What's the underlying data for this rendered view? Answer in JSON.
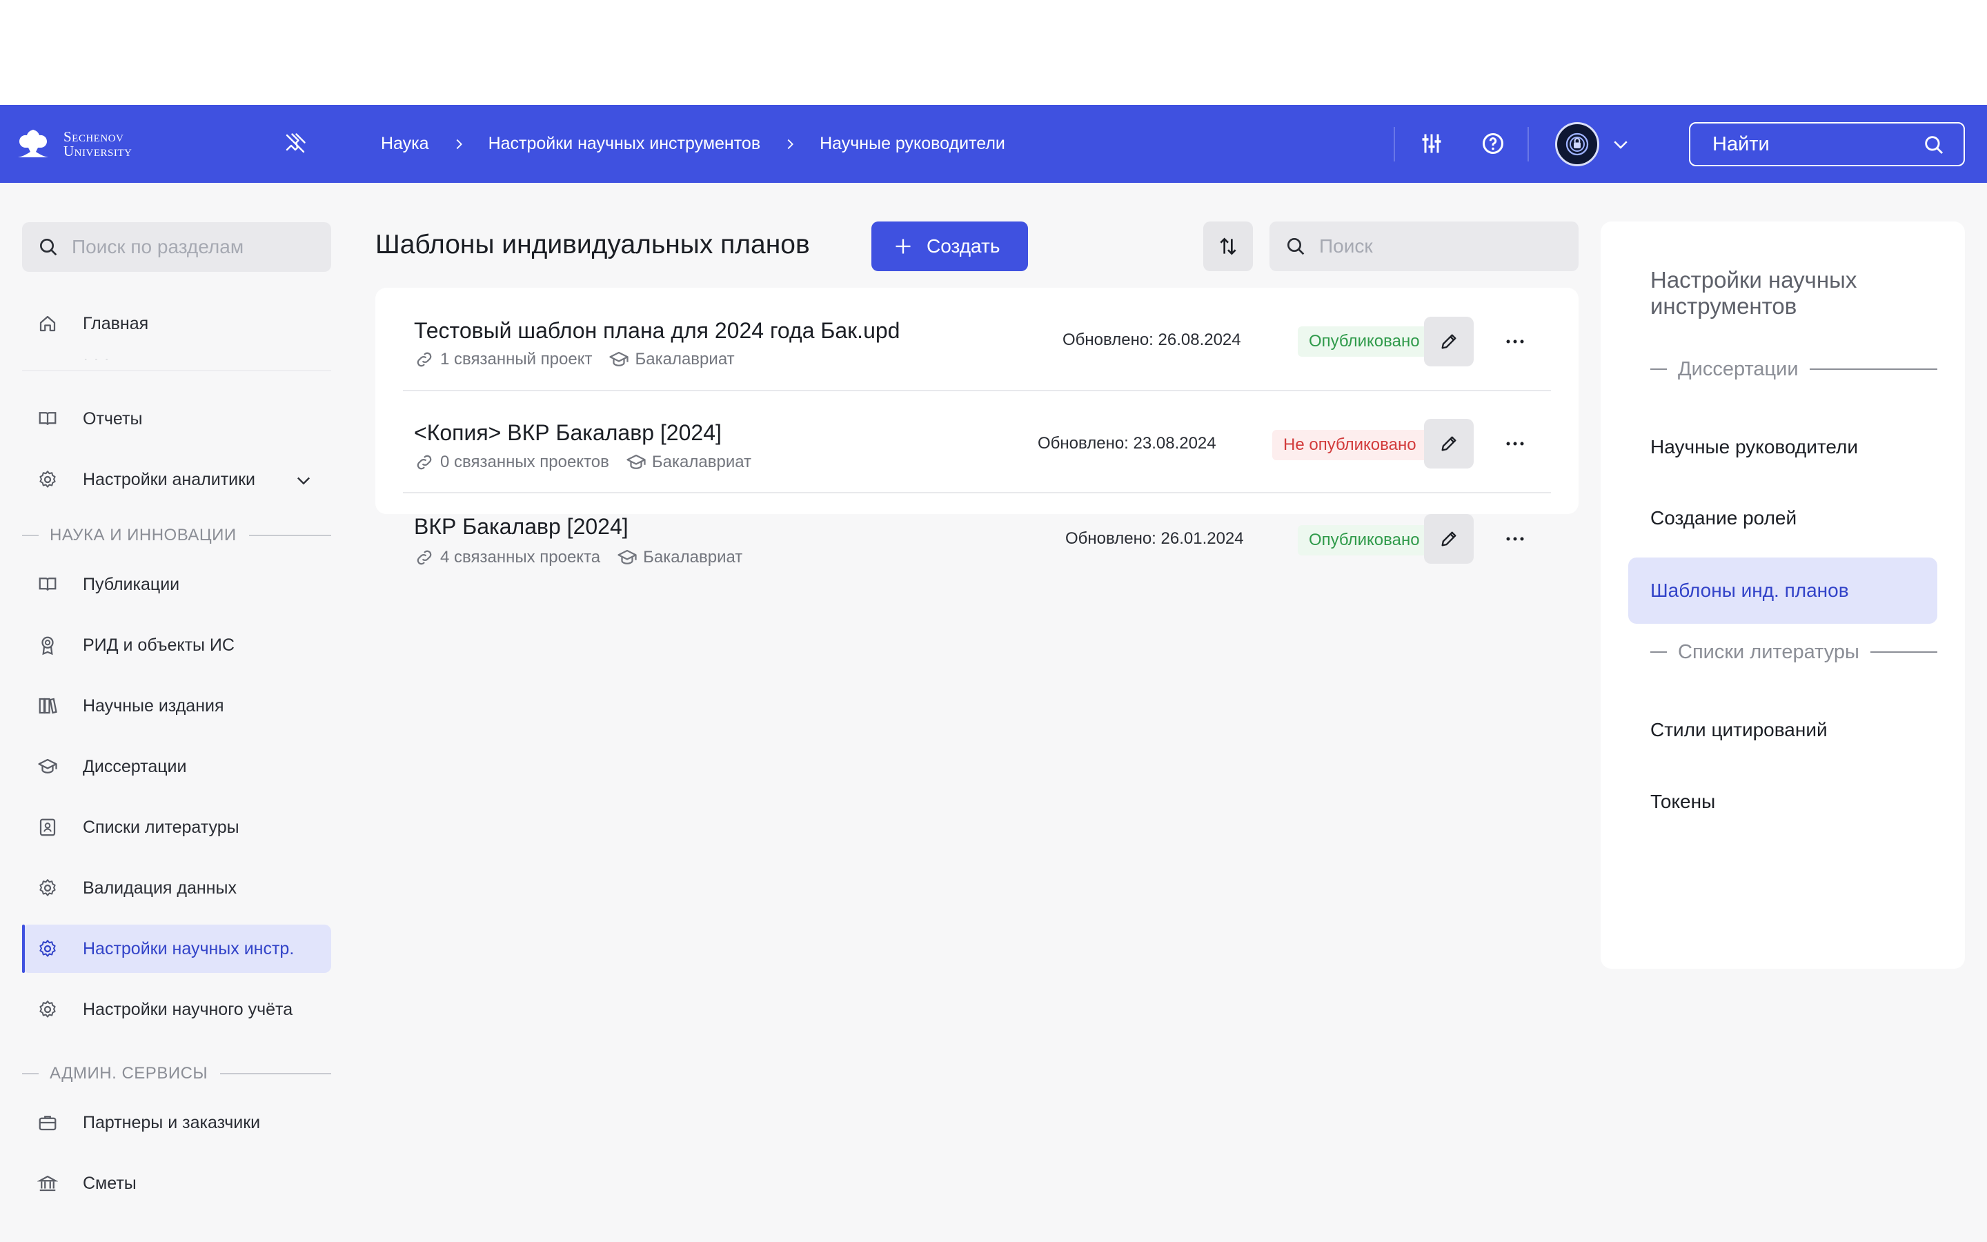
{
  "header": {
    "logo_line1": "Sechenov",
    "logo_line2": "University",
    "breadcrumbs": [
      "Наука",
      "Настройки научных инструментов",
      "Научные руководители"
    ],
    "search_placeholder": "Найти"
  },
  "sidebar": {
    "search_placeholder": "Поиск по разделам",
    "items": [
      {
        "label": "Главная",
        "icon": "home-icon"
      },
      {
        "label": "Отчеты",
        "icon": "book-icon"
      },
      {
        "label": "Настройки аналитики",
        "icon": "gear-icon"
      },
      {
        "label": "Публикации",
        "icon": "book-icon"
      },
      {
        "label": "РИД и объекты ИС",
        "icon": "award-icon"
      },
      {
        "label": "Научные издания",
        "icon": "library-icon"
      },
      {
        "label": "Диссертации",
        "icon": "graduation-cap-icon"
      },
      {
        "label": "Списки литературы",
        "icon": "contact-book-icon"
      },
      {
        "label": "Валидация данных",
        "icon": "gear-icon"
      },
      {
        "label": "Настройки научных инстр.",
        "icon": "gear-icon",
        "active": true
      },
      {
        "label": "Настройки научного учёта",
        "icon": "gear-icon"
      },
      {
        "label": "Партнеры и заказчики",
        "icon": "briefcase-icon"
      },
      {
        "label": "Сметы",
        "icon": "bank-icon"
      }
    ],
    "sections": [
      "НАУКА И ИННОВАЦИИ",
      "АДМИН. СЕРВИСЫ"
    ]
  },
  "main": {
    "title": "Шаблоны индивидуальных планов",
    "create_label": "Создать",
    "search_placeholder": "Поиск",
    "rows": [
      {
        "title": "Тестовый шаблон плана для 2024 года Бак.upd",
        "links": "1 связанный проект",
        "level": "Бакалавриат",
        "updated": "Обновлено: 26.08.2024",
        "status": "Опубликовано",
        "published": true
      },
      {
        "title": "<Копия> ВКР Бакалавр [2024]",
        "links": "0 связанных проектов",
        "level": "Бакалавриат",
        "updated": "Обновлено: 23.08.2024",
        "status": "Не опубликовано",
        "published": false
      },
      {
        "title": "ВКР Бакалавр [2024]",
        "links": "4 связанных проекта",
        "level": "Бакалавриат",
        "updated": "Обновлено: 26.01.2024",
        "status": "Опубликовано",
        "published": true
      }
    ]
  },
  "right_panel": {
    "title": "Настройки научных инструментов",
    "section1": "Диссертации",
    "items1": [
      "Научные руководители",
      "Создание ролей",
      "Шаблоны инд. планов"
    ],
    "section2": "Списки литературы",
    "items2": [
      "Стили цитирований",
      "Токены"
    ]
  },
  "colors": {
    "brand": "#3f51e0",
    "published": "#2f9a4a",
    "unpublished": "#d23b3b"
  }
}
